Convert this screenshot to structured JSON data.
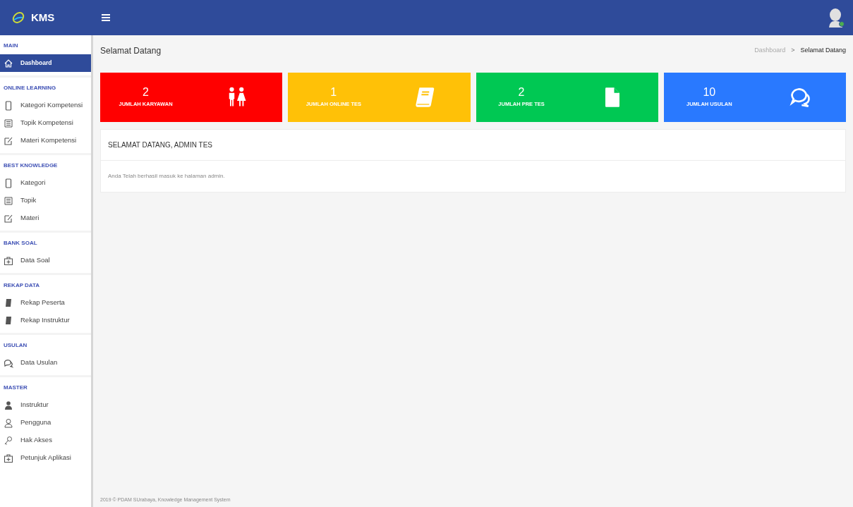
{
  "brand": {
    "title": "KMS"
  },
  "sidebar": {
    "sections": [
      {
        "heading": "MAIN",
        "items": [
          {
            "label": "Dashboard",
            "kind": "home",
            "selected": true
          }
        ]
      },
      {
        "heading": "ONLINE LEARNING",
        "items": [
          {
            "label": "Kategori Kompetensi",
            "kind": "tablet",
            "selected": false
          },
          {
            "label": "Topik Kompetensi",
            "kind": "list",
            "selected": false
          },
          {
            "label": "Materi Kompetensi",
            "kind": "edit",
            "selected": false
          }
        ]
      },
      {
        "heading": "BEST KNOWLEDGE",
        "items": [
          {
            "label": "Kategori",
            "kind": "tablet",
            "selected": false
          },
          {
            "label": "Topik",
            "kind": "list",
            "selected": false
          },
          {
            "label": "Materi",
            "kind": "edit",
            "selected": false
          }
        ]
      },
      {
        "heading": "BANK SOAL",
        "items": [
          {
            "label": "Data Soal",
            "kind": "kit",
            "selected": false
          }
        ]
      },
      {
        "heading": "REKAP DATA",
        "items": [
          {
            "label": "Rekap Peserta",
            "kind": "book",
            "selected": false
          },
          {
            "label": "Rekap Instruktur",
            "kind": "book",
            "selected": false
          }
        ]
      },
      {
        "heading": "USULAN",
        "items": [
          {
            "label": "Data Usulan",
            "kind": "chat",
            "selected": false
          }
        ]
      },
      {
        "heading": "MASTER",
        "items": [
          {
            "label": "Instruktur",
            "kind": "user",
            "selected": false
          },
          {
            "label": "Pengguna",
            "kind": "user-outline",
            "selected": false
          },
          {
            "label": "Hak Akses",
            "kind": "key",
            "selected": false
          },
          {
            "label": "Petunjuk Aplikasi",
            "kind": "kit",
            "selected": false
          }
        ]
      }
    ]
  },
  "page_title": "Selamat Datang",
  "breadcrumb": [
    {
      "label": "Dashboard",
      "kind": "link"
    },
    {
      "label": ">",
      "kind": "separator"
    },
    {
      "label": "Selamat Datang",
      "kind": "current"
    }
  ],
  "stats": [
    {
      "value": "2",
      "label": "JUMLAH KARYAWAN",
      "kind": "people",
      "color": "#ff0000"
    },
    {
      "value": "1",
      "label": "JUMLAH ONLINE TES",
      "kind": "book",
      "color": "#ffc107"
    },
    {
      "value": "2",
      "label": "JUMLAH PRE TES",
      "kind": "file",
      "color": "#00c853"
    },
    {
      "value": "10",
      "label": "JUMLAH USULAN",
      "kind": "chat",
      "color": "#2979ff"
    }
  ],
  "panel": {
    "title": "SELAMAT DATANG, ADMIN TES",
    "body": "Anda Telah berhasil masuk ke halaman admin."
  },
  "footer": "2019 © PDAM SUrabaya, Knowledge Management System"
}
